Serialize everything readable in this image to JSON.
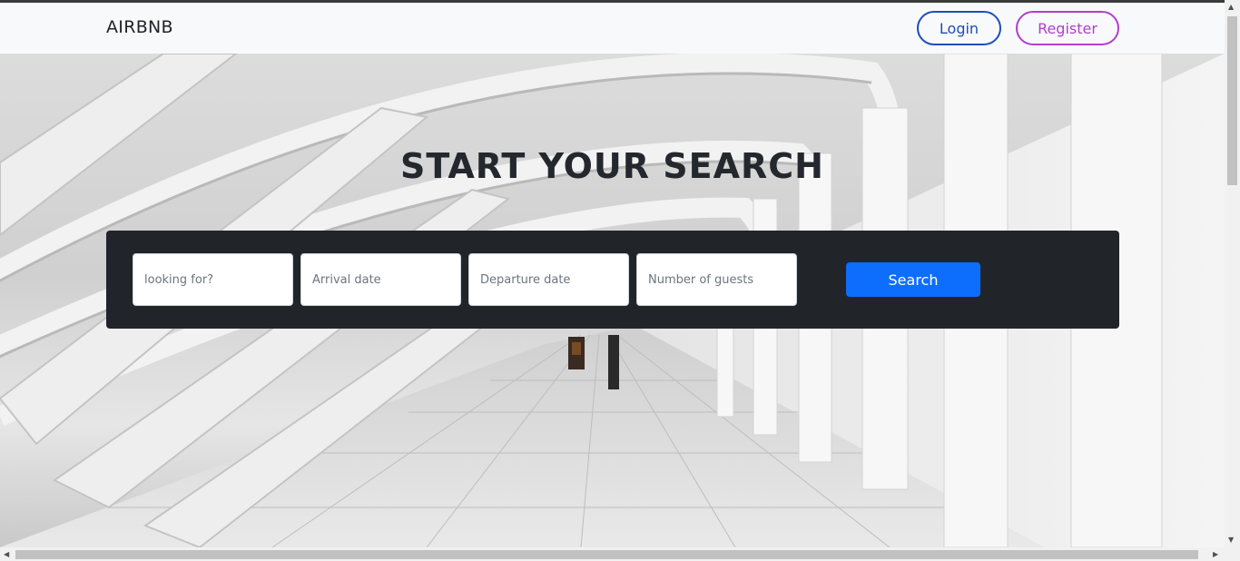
{
  "navbar": {
    "brand": "AIRBNB",
    "login_label": "Login",
    "register_label": "Register"
  },
  "hero": {
    "title": "START YOUR SEARCH"
  },
  "search": {
    "looking_for_placeholder": "looking for?",
    "arrival_placeholder": "Arrival date",
    "departure_placeholder": "Departure date",
    "guests_placeholder": "Number of guests",
    "button_label": "Search"
  },
  "colors": {
    "login_accent": "#1d4fb8",
    "register_accent": "#b23ecf",
    "search_button": "#0d6efd",
    "panel_background": "#212529"
  },
  "icons": {
    "scroll_up": "chevron-up-icon",
    "scroll_down": "chevron-down-icon",
    "scroll_left": "chevron-left-icon",
    "scroll_right": "chevron-right-icon"
  }
}
